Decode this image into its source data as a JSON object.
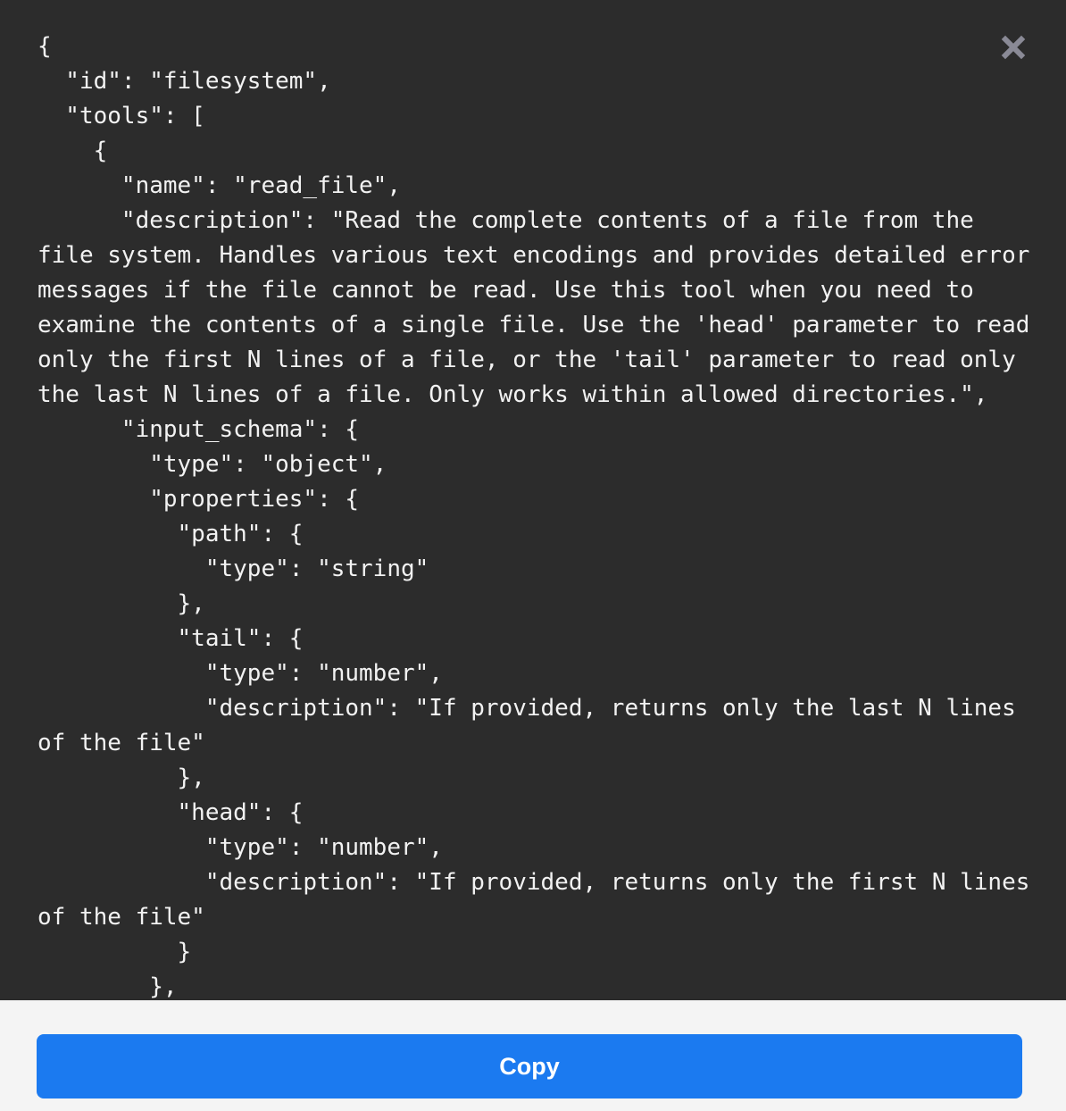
{
  "modal": {
    "close_icon": "close-x-icon",
    "code_lines": [
      "{",
      "  \"id\": \"filesystem\",",
      "  \"tools\": [",
      "    {",
      "      \"name\": \"read_file\",",
      "      \"description\": \"Read the complete contents of a file from the",
      "file system. Handles various text encodings and provides detailed error",
      "messages if the file cannot be read. Use this tool when you need to",
      "examine the contents of a single file. Use the 'head' parameter to read",
      "only the first N lines of a file, or the 'tail' parameter to read only",
      "the last N lines of a file. Only works within allowed directories.\",",
      "      \"input_schema\": {",
      "        \"type\": \"object\",",
      "        \"properties\": {",
      "          \"path\": {",
      "            \"type\": \"string\"",
      "          },",
      "          \"tail\": {",
      "            \"type\": \"number\",",
      "            \"description\": \"If provided, returns only the last N lines",
      "of the file\"",
      "          },",
      "          \"head\": {",
      "            \"type\": \"number\",",
      "            \"description\": \"If provided, returns only the first N lines",
      "of the file\"",
      "          }",
      "        },"
    ],
    "copy_label": "Copy",
    "colors": {
      "background": "#2c2c2c",
      "footer": "#f4f4f4",
      "button": "#1b7af0"
    }
  }
}
